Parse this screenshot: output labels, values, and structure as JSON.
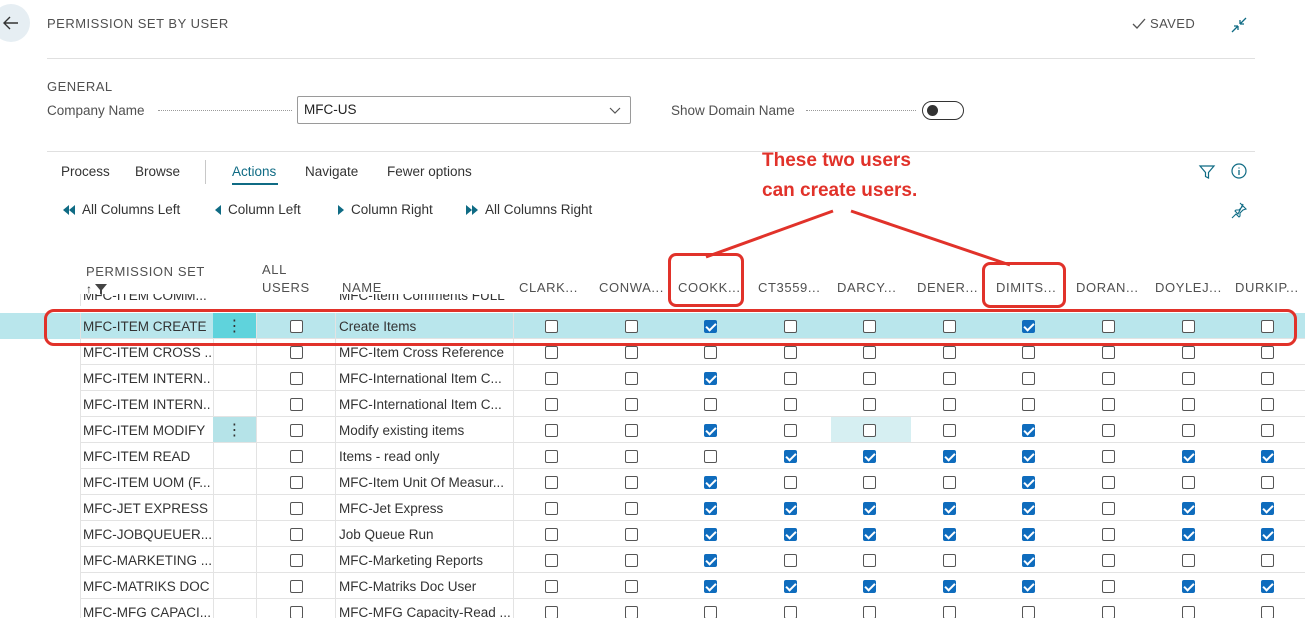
{
  "header": {
    "title": "PERMISSION SET BY USER",
    "saved_label": "SAVED"
  },
  "general": {
    "section_label": "GENERAL",
    "company_label": "Company Name",
    "company_value": "MFC-US",
    "domain_label": "Show Domain Name",
    "domain_toggle_on": false
  },
  "tabs": [
    "Process",
    "Browse",
    "Actions",
    "Navigate",
    "Fewer options"
  ],
  "actions": [
    "All Columns Left",
    "Column Left",
    "Column Right",
    "All Columns Right"
  ],
  "columns": {
    "permission_set": "PERMISSION SET",
    "all_users_1": "ALL",
    "all_users_2": "USERS",
    "name": "NAME",
    "users": [
      "CLARK...",
      "CONWA...",
      "COOKK...",
      "CT3559...",
      "DARCY...",
      "DENER...",
      "DIMITS...",
      "DORAN...",
      "DOYLEJ...",
      "DURKIP..."
    ]
  },
  "partial_top": {
    "set": "MFC-ITEM COMM...",
    "name": "MFC-Item Comments FULL"
  },
  "rows": [
    {
      "set": "MFC-ITEM CREATE",
      "name": "Create Items",
      "all": false,
      "u": [
        0,
        0,
        1,
        0,
        0,
        0,
        1,
        0,
        0,
        0
      ]
    },
    {
      "set": "MFC-ITEM CROSS ...",
      "name": "MFC-Item Cross Reference",
      "all": false,
      "u": [
        0,
        0,
        0,
        0,
        0,
        0,
        0,
        0,
        0,
        0
      ]
    },
    {
      "set": "MFC-ITEM INTERN...",
      "name": "MFC-International Item C...",
      "all": false,
      "u": [
        0,
        0,
        1,
        0,
        0,
        0,
        0,
        0,
        0,
        0
      ]
    },
    {
      "set": "MFC-ITEM INTERN...",
      "name": "MFC-International Item C...",
      "all": false,
      "u": [
        0,
        0,
        0,
        0,
        0,
        0,
        0,
        0,
        0,
        0
      ]
    },
    {
      "set": "MFC-ITEM MODIFY",
      "name": "Modify existing items",
      "all": false,
      "u": [
        0,
        0,
        1,
        0,
        0,
        0,
        1,
        0,
        0,
        0
      ]
    },
    {
      "set": "MFC-ITEM READ",
      "name": "Items - read only",
      "all": false,
      "u": [
        0,
        0,
        0,
        1,
        1,
        1,
        1,
        0,
        1,
        1
      ]
    },
    {
      "set": "MFC-ITEM UOM (F...",
      "name": "MFC-Item Unit Of Measur...",
      "all": false,
      "u": [
        0,
        0,
        1,
        0,
        0,
        0,
        1,
        0,
        0,
        0
      ]
    },
    {
      "set": "MFC-JET EXPRESS",
      "name": "MFC-Jet Express",
      "all": false,
      "u": [
        0,
        0,
        1,
        1,
        1,
        1,
        1,
        0,
        1,
        1
      ]
    },
    {
      "set": "MFC-JOBQUEUER...",
      "name": "Job Queue Run",
      "all": false,
      "u": [
        0,
        0,
        1,
        1,
        1,
        1,
        1,
        0,
        1,
        1
      ]
    },
    {
      "set": "MFC-MARKETING ...",
      "name": "MFC-Marketing Reports",
      "all": false,
      "u": [
        0,
        0,
        1,
        0,
        0,
        0,
        1,
        0,
        0,
        0
      ]
    },
    {
      "set": "MFC-MATRIKS DOC",
      "name": "MFC-Matriks Doc User",
      "all": false,
      "u": [
        0,
        0,
        1,
        1,
        1,
        1,
        1,
        0,
        1,
        1
      ]
    },
    {
      "set": "MFC-MFG CAPACI...",
      "name": "MFC-MFG Capacity-Read ...",
      "all": false,
      "u": [
        0,
        0,
        0,
        0,
        0,
        0,
        0,
        0,
        0,
        0
      ]
    }
  ],
  "annotation": {
    "line1": "These two users",
    "line2": "can create users."
  },
  "colors": {
    "accent": "#0f6b84",
    "selected_row": "#b9e6ec",
    "checkbox_on": "#0f6cbd",
    "annotation": "#e1322a"
  }
}
